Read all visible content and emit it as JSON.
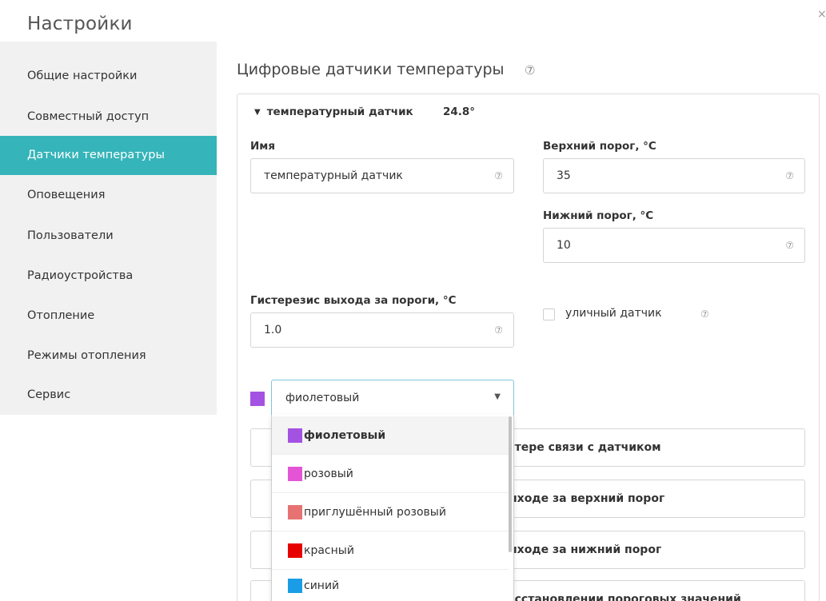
{
  "window": {
    "title": "Настройки",
    "close_glyph": "×"
  },
  "sidebar": {
    "items": [
      {
        "label": "Общие настройки"
      },
      {
        "label": "Совместный доступ"
      },
      {
        "label": "Датчики температуры",
        "active": true
      },
      {
        "label": "Оповещения"
      },
      {
        "label": "Пользователи"
      },
      {
        "label": "Радиоустройства"
      },
      {
        "label": "Отопление"
      },
      {
        "label": "Режимы отопления"
      },
      {
        "label": "Сервис"
      }
    ]
  },
  "main": {
    "title": "Цифровые датчики температуры",
    "help_glyph": "⑦",
    "sensor": {
      "name_header": "температурный датчик",
      "temperature": "24.8°",
      "expanded_glyph": "▼",
      "fields": {
        "name": {
          "label": "Имя",
          "value": "температурный датчик"
        },
        "upper": {
          "label": "Верхний порог, °C",
          "value": "35"
        },
        "lower": {
          "label": "Нижний порог, °C",
          "value": "10"
        },
        "hysteresis": {
          "label": "Гистерезис выхода за пороги, °C",
          "value": "1.0"
        }
      },
      "outdoor": {
        "label": "уличный датчик",
        "checked": false
      },
      "color": {
        "selected": "фиолетовый",
        "swatch": "#a452e2",
        "arrow": "▼"
      }
    },
    "notifications": [
      {
        "text": "отере связи с датчиком"
      },
      {
        "text": "ыходе за верхний порог"
      },
      {
        "text": "ыходе за нижний порог"
      },
      {
        "text": "осстановлении пороговых значений"
      }
    ]
  },
  "dropdown": {
    "options": [
      {
        "label": "фиолетовый",
        "color": "#a452e2",
        "selected": true
      },
      {
        "label": "розовый",
        "color": "#e455d6"
      },
      {
        "label": "приглушённый розовый",
        "color": "#e77272"
      },
      {
        "label": "красный",
        "color": "#e60000"
      },
      {
        "label": "синий",
        "color": "#1a9de6"
      }
    ]
  },
  "colors": {
    "accent": "#35b4b9",
    "sidebar_bg": "#f1f1f1"
  }
}
